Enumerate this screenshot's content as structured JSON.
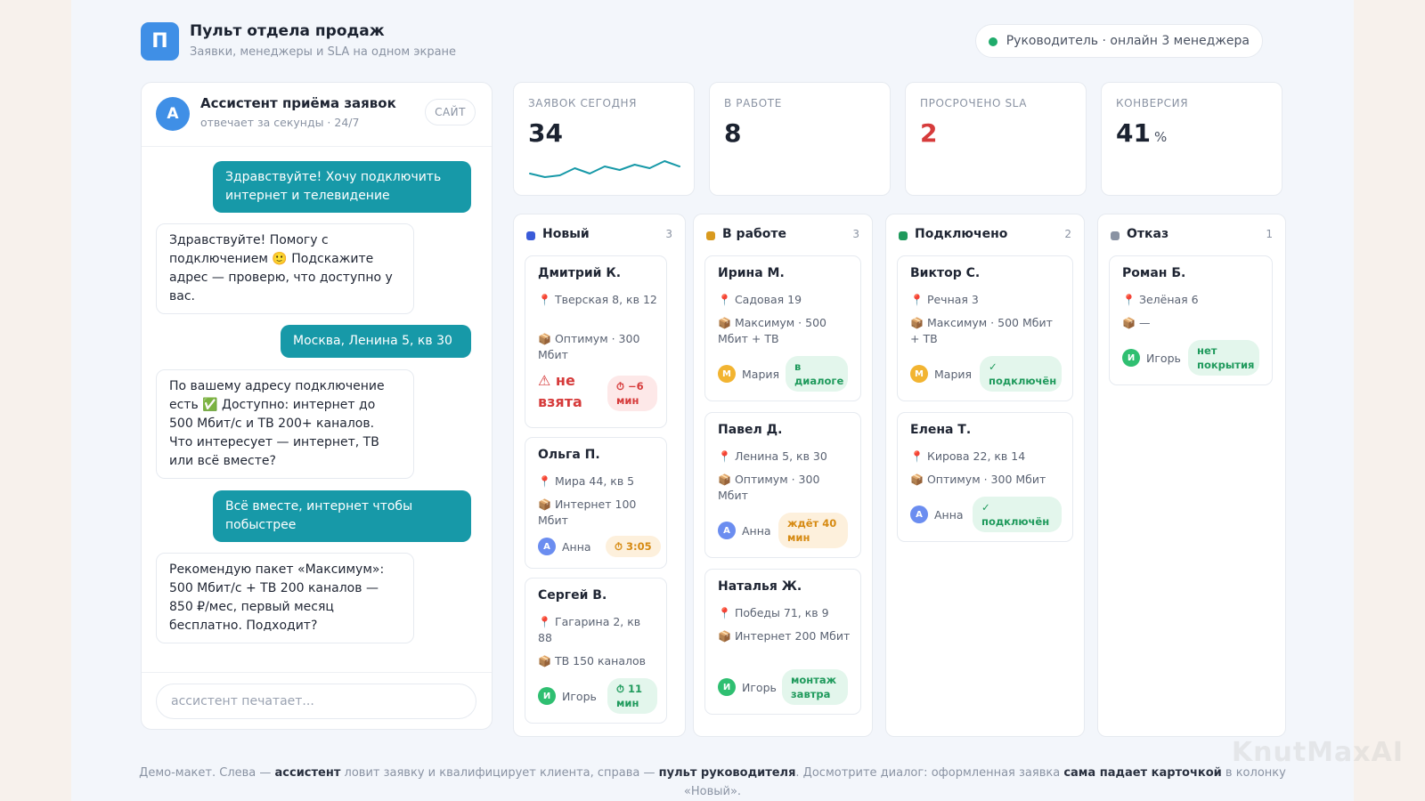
{
  "header": {
    "logo_letter": "П",
    "title": "Пульт отдела продаж",
    "subtitle": "Заявки, менеджеры и SLA на одном экране",
    "status": "Руководитель · онлайн 3 менеджера"
  },
  "chat": {
    "avatar": "А",
    "title": "Ассистент приёма заявок",
    "subtitle": "отвечает за секунды · 24/7",
    "badge": "САЙТ",
    "messages": [
      {
        "from": "client",
        "text": "Здравствуйте! Хочу подключить интернет и телевидение"
      },
      {
        "from": "assistant",
        "text": "Здравствуйте! Помогу с подключением 🙂 Подскажите адрес — проверю, что доступно у вас."
      },
      {
        "from": "client",
        "text": "Москва, Ленина 5, кв 30"
      },
      {
        "from": "assistant",
        "text": "По вашему адресу подключение есть ✅ Доступно: интернет до 500 Мбит/с и ТВ 200+ каналов. Что интересует — интернет, ТВ или всё вместе?"
      },
      {
        "from": "client",
        "text": "Всё вместе, интернет чтобы побыстрее"
      },
      {
        "from": "assistant",
        "text": "Рекомендую пакет «Максимум»: 500 Мбит/с + ТВ 200 каналов — 850 ₽/мес, первый месяц бесплатно. Подходит?"
      }
    ],
    "input_placeholder": "ассистент печатает..."
  },
  "kpis": [
    {
      "label": "ЗАЯВОК СЕГОДНЯ",
      "value": "34",
      "unit": "",
      "sparkline": [
        5,
        3,
        4,
        8,
        5,
        9,
        7,
        10,
        8,
        12,
        9
      ]
    },
    {
      "label": "В РАБОТЕ",
      "value": "8",
      "unit": ""
    },
    {
      "label": "ПРОСРОЧЕНО SLA",
      "value": "2",
      "unit": ""
    },
    {
      "label": "КОНВЕРСИЯ",
      "value": "41",
      "unit": "%"
    }
  ],
  "columns": [
    {
      "title": "Новый",
      "count": "3",
      "color": "#3a5bd9",
      "cards": [
        {
          "name": "Дмитрий К.",
          "address": "Тверская 8, кв 12",
          "plan": "Оптимум · 300 Мбит",
          "overdue": "⚠ не взята",
          "tag": "⏱ −6 мин",
          "tag_style": "red"
        },
        {
          "name": "Ольга П.",
          "address": "Мира 44, кв 5",
          "plan": "Интернет 100 Мбит",
          "manager": "Анна",
          "manager_initial": "А",
          "manager_color": "#6b8df0",
          "tag": "⏱ 3:05",
          "tag_style": "amber"
        },
        {
          "name": "Сергей В.",
          "address": "Гагарина 2, кв 88",
          "plan": "ТВ 150 каналов",
          "manager": "Игорь",
          "manager_initial": "И",
          "manager_color": "#2fbf71",
          "tag": "⏱ 11 мин",
          "tag_style": "green"
        }
      ]
    },
    {
      "title": "В работе",
      "count": "3",
      "color": "#d99a1e",
      "cards": [
        {
          "name": "Ирина М.",
          "address": "Садовая 19",
          "plan": "Максимум · 500 Мбит + ТВ",
          "manager": "Мария",
          "manager_initial": "М",
          "manager_color": "#f2b431",
          "tag": "в диалоге",
          "tag_style": "green"
        },
        {
          "name": "Павел Д.",
          "address": "Ленина 5, кв 30",
          "plan": "Оптимум · 300 Мбит",
          "manager": "Анна",
          "manager_initial": "А",
          "manager_color": "#6b8df0",
          "tag": "ждёт 40 мин",
          "tag_style": "amber"
        },
        {
          "name": "Наталья Ж.",
          "address": "Победы 71, кв 9",
          "plan": "Интернет 200 Мбит",
          "manager": "Игорь",
          "manager_initial": "И",
          "manager_color": "#2fbf71",
          "tag": "монтаж завтра",
          "tag_style": "green"
        }
      ]
    },
    {
      "title": "Подключено",
      "count": "2",
      "color": "#1f9a5c",
      "cards": [
        {
          "name": "Виктор С.",
          "address": "Речная 3",
          "plan": "Максимум · 500 Мбит + ТВ",
          "manager": "Мария",
          "manager_initial": "М",
          "manager_color": "#f2b431",
          "tag": "✓ подключён",
          "tag_style": "green"
        },
        {
          "name": "Елена Т.",
          "address": "Кирова 22, кв 14",
          "plan": "Оптимум · 300 Мбит",
          "manager": "Анна",
          "manager_initial": "А",
          "manager_color": "#6b8df0",
          "tag": "✓ подключён",
          "tag_style": "green"
        }
      ]
    },
    {
      "title": "Отказ",
      "count": "1",
      "color": "#8a93a3",
      "cards": [
        {
          "name": "Роман Б.",
          "address": "Зелёная 6",
          "plan": "—",
          "manager": "Игорь",
          "manager_initial": "И",
          "manager_color": "#2fbf71",
          "tag": "нет покрытия",
          "tag_style": "green"
        }
      ]
    }
  ],
  "footer": {
    "p1": "Демо-макет. Слева — ",
    "b1": "ассистент",
    "p2": " ловит заявку и квалифицирует клиента, справа — ",
    "b2": "пульт руководителя",
    "p3": ". Досмотрите диалог: оформленная заявка ",
    "b3": "сама падает карточкой",
    "p4": " в колонку «Новый»."
  },
  "watermark": "KnutMaxAI"
}
